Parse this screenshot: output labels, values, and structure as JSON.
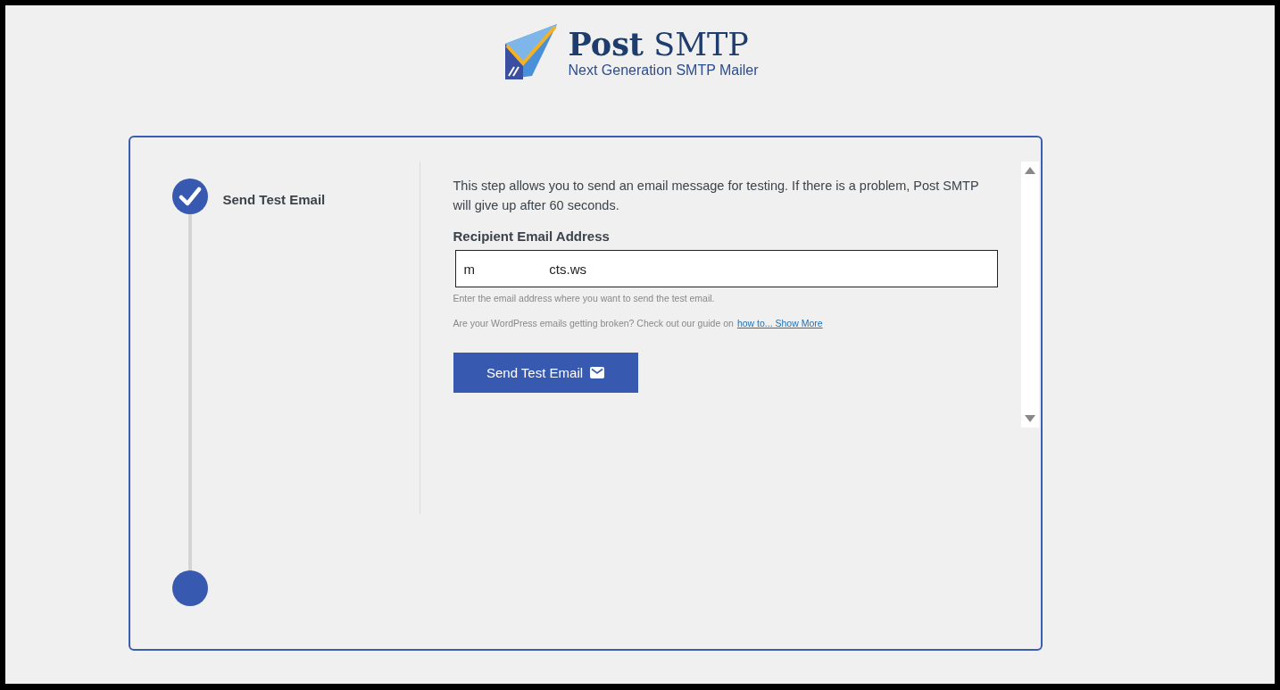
{
  "logo": {
    "title": "**Post** SMTP",
    "tagline": "Next Generation SMTP Mailer"
  },
  "steps": [
    {
      "label": "Send Test Email",
      "completed": true
    },
    {
      "completed": false
    }
  ],
  "description": "This step allows you to send an email message for testing. If there is a problem, Post SMTP will give up after 60 seconds.",
  "recipient_field": {
    "label": "Recipient Email Address",
    "value": "m                    cts.ws",
    "hint": "Enter the email address where you want to send the test email."
  },
  "guide": {
    "text": "Are your WordPress emails getting broken? Check out our guide on",
    "link": "how to... Show More"
  },
  "button": {
    "label": "Send Test Email"
  }
}
